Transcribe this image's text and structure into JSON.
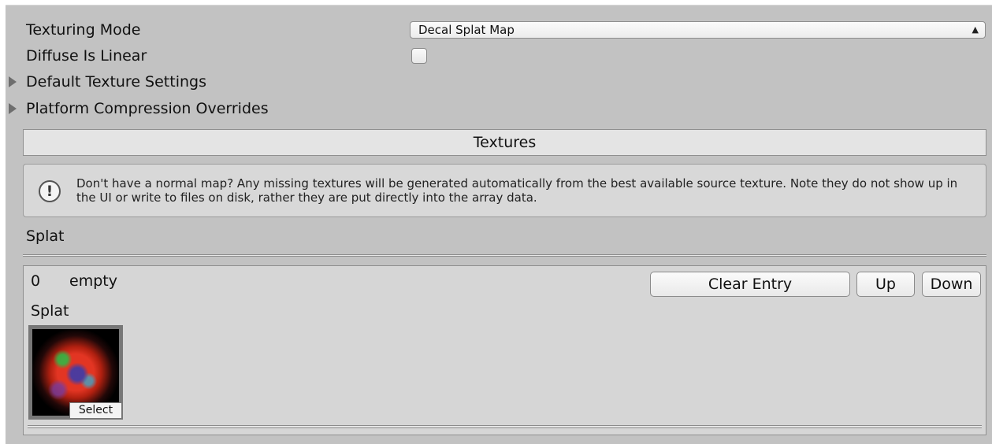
{
  "settings": {
    "texturing_mode_label": "Texturing Mode",
    "texturing_mode_value": "Decal Splat Map",
    "diffuse_linear_label": "Diffuse Is Linear",
    "diffuse_linear_checked": false,
    "default_texture_settings": "Default Texture Settings",
    "platform_overrides": "Platform Compression Overrides"
  },
  "textures_header": "Textures",
  "help_text": "Don't have a normal map? Any missing textures will be generated automatically from the best available source texture. Note they do not show up in the UI or write to files on disk, rather they are put directly into the array data.",
  "splat_section_label": "Splat",
  "entry": {
    "index": "0",
    "name": "empty",
    "clear_label": "Clear Entry",
    "up_label": "Up",
    "down_label": "Down",
    "slot_label": "Splat",
    "select_label": "Select"
  },
  "colors": {
    "panel_bg": "#c2c2c2",
    "header_bg": "#e4e4e4",
    "entry_bg": "#d6d6d6"
  }
}
